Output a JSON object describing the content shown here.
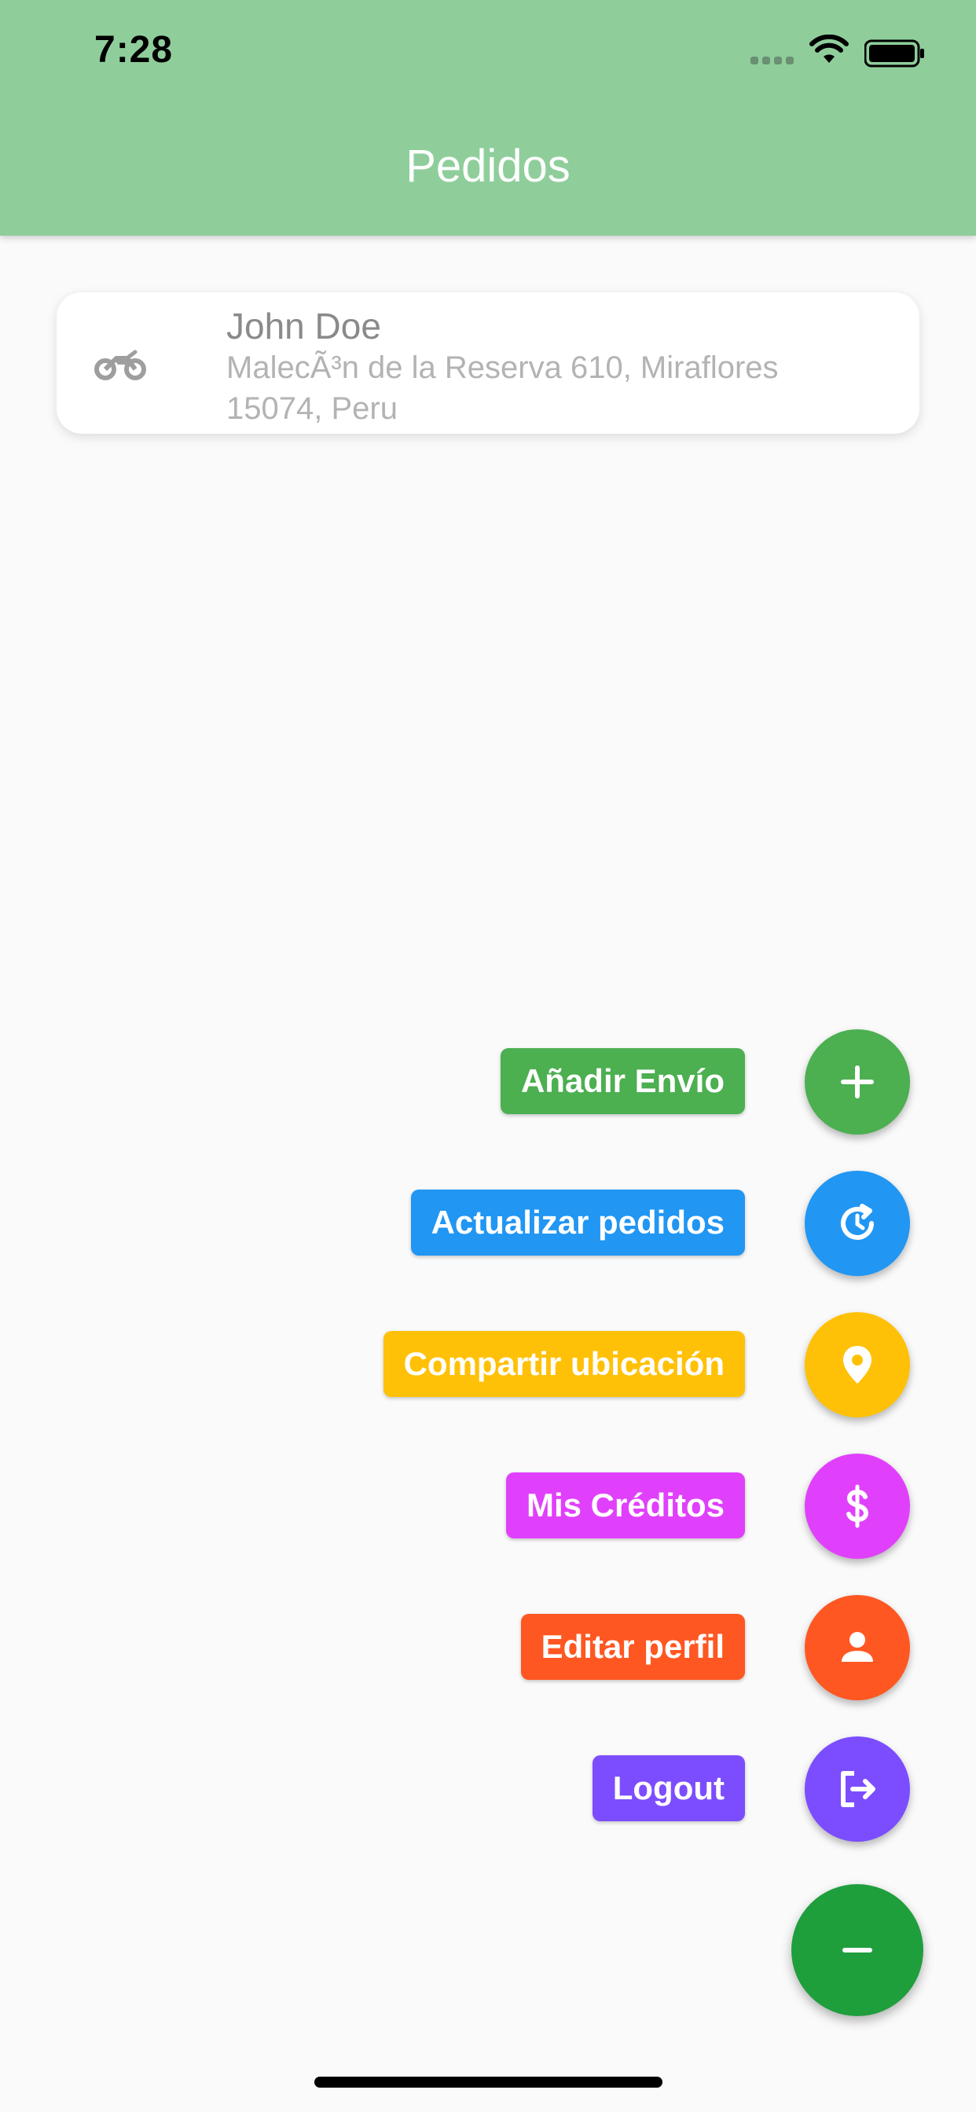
{
  "status_bar": {
    "time": "7:28"
  },
  "header": {
    "title": "Pedidos"
  },
  "orders": [
    {
      "icon": "motorcycle-icon",
      "name": "John Doe",
      "address": "MalecÃ³n de la Reserva 610, Miraflores 15074, Peru"
    }
  ],
  "actions": [
    {
      "label": "Añadir Envío",
      "icon": "plus-icon",
      "color": "#4caf50"
    },
    {
      "label": "Actualizar pedidos",
      "icon": "refresh-clock-icon",
      "color": "#2196f3"
    },
    {
      "label": "Compartir ubicación",
      "icon": "location-pin-icon",
      "color": "#ffc107"
    },
    {
      "label": "Mis Créditos",
      "icon": "dollar-icon",
      "color": "#e040fb"
    },
    {
      "label": "Editar perfil",
      "icon": "person-icon",
      "color": "#ff5722"
    },
    {
      "label": "Logout",
      "icon": "logout-icon",
      "color": "#7c4dff"
    }
  ],
  "main_fab": {
    "icon": "minus-icon",
    "color": "#1f9e3c"
  },
  "colors": {
    "header": "#8fce9b",
    "background": "#fafafa"
  }
}
